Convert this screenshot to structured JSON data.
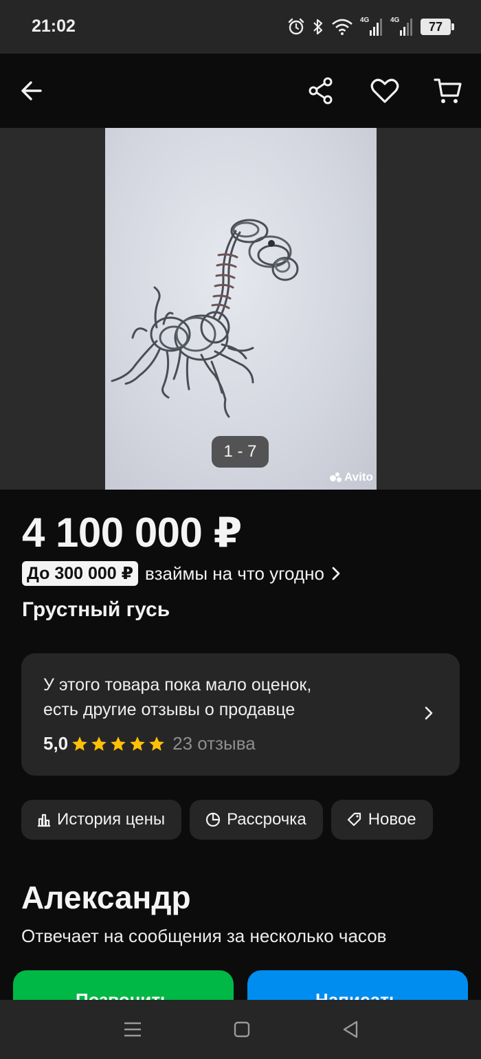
{
  "status_bar": {
    "time": "21:02",
    "network_1": "4G",
    "network_2": "4G",
    "battery": "77",
    "icons": [
      "alarm-icon",
      "bluetooth-icon",
      "wifi-icon",
      "signal-icon",
      "signal-icon",
      "battery-icon"
    ]
  },
  "toolbar": {
    "icons": [
      "back-arrow-icon",
      "share-icon",
      "heart-icon",
      "cart-icon"
    ]
  },
  "gallery": {
    "counter": "1 - 7",
    "watermark": "Avito"
  },
  "listing": {
    "price": "4 100 000 ₽",
    "loan_badge": "До 300 000 ₽",
    "loan_text": "взаймы на что угодно",
    "title": "Грустный гусь"
  },
  "reviews": {
    "line1": "У этого товара пока мало оценок,",
    "line2": "есть другие отзывы о продавце",
    "score": "5,0",
    "stars": 5,
    "count": "23 отзыва",
    "star_color": "#ffc107"
  },
  "chips": [
    {
      "label": "История цены",
      "icon": "bar-chart-icon"
    },
    {
      "label": "Рассрочка",
      "icon": "pie-chart-icon"
    },
    {
      "label": "Новое",
      "icon": "tag-icon"
    }
  ],
  "seller": {
    "name": "Александр",
    "status": "Отвечает на сообщения за несколько часов"
  },
  "actions": {
    "call_label": "Позвонить",
    "write_label": "Написать",
    "call_color": "#00b845",
    "write_color": "#008df0"
  }
}
